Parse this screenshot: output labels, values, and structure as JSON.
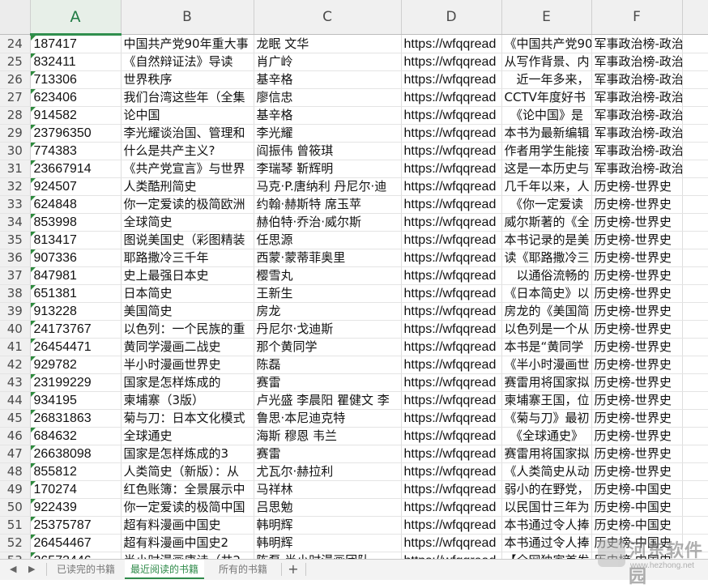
{
  "columns": [
    "A",
    "B",
    "C",
    "D",
    "E",
    "F"
  ],
  "rows": [
    {
      "n": "24",
      "a": "187417",
      "b": "中国共产党90年重大事",
      "c": "龙眠 文华",
      "d": "https://wfqqread",
      "e": "《中国共产党90",
      "f": "军事政治榜-政治"
    },
    {
      "n": "25",
      "a": "832411",
      "b": "《自然辩证法》导读",
      "c": "肖广岭",
      "d": "https://wfqqread",
      "e": "从写作背景、内",
      "f": "军事政治榜-政治"
    },
    {
      "n": "26",
      "a": "713306",
      "b": "世界秩序",
      "c": "基辛格",
      "d": "https://wfqqread",
      "e": "　近一年多来，",
      "f": "军事政治榜-政治"
    },
    {
      "n": "27",
      "a": "623406",
      "b": "我们台湾这些年（全集",
      "c": "廖信忠",
      "d": "https://wfqqread",
      "e": "CCTV年度好书",
      "f": "军事政治榜-政治"
    },
    {
      "n": "28",
      "a": "914582",
      "b": "论中国",
      "c": "基辛格",
      "d": "https://wfqqread",
      "e": "　《论中国》是",
      "f": "军事政治榜-政治"
    },
    {
      "n": "29",
      "a": "23796350",
      "b": "李光耀谈治国、管理和",
      "c": "李光耀",
      "d": "https://wfqqread",
      "e": "本书为最新编辑",
      "f": "军事政治榜-政治"
    },
    {
      "n": "30",
      "a": "774383",
      "b": "什么是共产主义?",
      "c": "阎振伟 曾筱琪",
      "d": "https://wfqqread",
      "e": "作者用学生能接",
      "f": "军事政治榜-政治"
    },
    {
      "n": "31",
      "a": "23667914",
      "b": "《共产党宣言》与世界",
      "c": "李瑞琴 靳辉明",
      "d": "https://wfqqread",
      "e": "这是一本历史与",
      "f": "军事政治榜-政治"
    },
    {
      "n": "32",
      "a": "924507",
      "b": "人类酷刑简史",
      "c": "马克·P.唐纳利 丹尼尔·迪",
      "d": "https://wfqqread",
      "e": "几千年以来，人",
      "f": "历史榜-世界史"
    },
    {
      "n": "33",
      "a": "624848",
      "b": "你一定爱读的极简欧洲",
      "c": "约翰·赫斯特 席玉苹",
      "d": "https://wfqqread",
      "e": "　《你一定爱读",
      "f": "历史榜-世界史"
    },
    {
      "n": "34",
      "a": "853998",
      "b": "全球简史",
      "c": "赫伯特·乔治·威尔斯",
      "d": "https://wfqqread",
      "e": "威尔斯著的《全",
      "f": "历史榜-世界史"
    },
    {
      "n": "35",
      "a": "813417",
      "b": "图说美国史（彩图精装",
      "c": "任思源",
      "d": "https://wfqqread",
      "e": "本书记录的是美",
      "f": "历史榜-世界史"
    },
    {
      "n": "36",
      "a": "907336",
      "b": "耶路撒冷三千年",
      "c": "西蒙·蒙蒂菲奥里",
      "d": "https://wfqqread",
      "e": "读《耶路撒冷三",
      "f": "历史榜-世界史"
    },
    {
      "n": "37",
      "a": "847981",
      "b": "史上最强日本史",
      "c": "樱雪丸",
      "d": "https://wfqqread",
      "e": "　以通俗流畅的",
      "f": "历史榜-世界史"
    },
    {
      "n": "38",
      "a": "651381",
      "b": "日本简史",
      "c": "王新生",
      "d": "https://wfqqread",
      "e": "《日本简史》以",
      "f": "历史榜-世界史"
    },
    {
      "n": "39",
      "a": "913228",
      "b": "美国简史",
      "c": "房龙",
      "d": "https://wfqqread",
      "e": "房龙的《美国简",
      "f": "历史榜-世界史"
    },
    {
      "n": "40",
      "a": "24173767",
      "b": "以色列：一个民族的重",
      "c": "丹尼尔·戈迪斯",
      "d": "https://wfqqread",
      "e": "以色列是一个从",
      "f": "历史榜-世界史"
    },
    {
      "n": "41",
      "a": "26454471",
      "b": "黄同学漫画二战史",
      "c": "那个黄同学",
      "d": "https://wfqqread",
      "e": "本书是“黄同学",
      "f": "历史榜-世界史"
    },
    {
      "n": "42",
      "a": "929782",
      "b": "半小时漫画世界史",
      "c": "陈磊",
      "d": "https://wfqqread",
      "e": "《半小时漫画世",
      "f": "历史榜-世界史"
    },
    {
      "n": "43",
      "a": "23199229",
      "b": "国家是怎样炼成的",
      "c": "赛雷",
      "d": "https://wfqqread",
      "e": "赛雷用将国家拟",
      "f": "历史榜-世界史"
    },
    {
      "n": "44",
      "a": "934195",
      "b": "柬埔寨（3版）",
      "c": "卢光盛 李晨阳 瞿健文 李",
      "d": "https://wfqqread",
      "e": "柬埔寨王国，位",
      "f": "历史榜-世界史"
    },
    {
      "n": "45",
      "a": "26831863",
      "b": "菊与刀：日本文化模式",
      "c": "鲁思·本尼迪克特",
      "d": "https://wfqqread",
      "e": "《菊与刀》最初",
      "f": "历史榜-世界史"
    },
    {
      "n": "46",
      "a": "684632",
      "b": "全球通史",
      "c": "海斯 穆恩 韦兰",
      "d": "https://wfqqread",
      "e": "　《全球通史》",
      "f": "历史榜-世界史"
    },
    {
      "n": "47",
      "a": "26638098",
      "b": "国家是怎样炼成的3",
      "c": "赛雷",
      "d": "https://wfqqread",
      "e": "赛雷用将国家拟",
      "f": "历史榜-世界史"
    },
    {
      "n": "48",
      "a": "855812",
      "b": "人类简史（新版）：从",
      "c": "尤瓦尔·赫拉利",
      "d": "https://wfqqread",
      "e": "《人类简史从动",
      "f": "历史榜-世界史"
    },
    {
      "n": "49",
      "a": "170274",
      "b": "红色账簿：全景展示中",
      "c": "马祥林",
      "d": "https://wfqqread",
      "e": "弱小的在野党，",
      "f": "历史榜-中国史"
    },
    {
      "n": "50",
      "a": "922439",
      "b": "你一定爱读的极简中国",
      "c": "吕思勉",
      "d": "https://wfqqread",
      "e": "以民国廿三年为",
      "f": "历史榜-中国史"
    },
    {
      "n": "51",
      "a": "25375787",
      "b": "超有料漫画中国史",
      "c": "韩明辉",
      "d": "https://wfqqread",
      "e": "本书通过令人捧",
      "f": "历史榜-中国史"
    },
    {
      "n": "52",
      "a": "26454467",
      "b": "超有料漫画中国史2",
      "c": "韩明辉",
      "d": "https://wfqqread",
      "e": "本书通过令人捧",
      "f": "历史榜-中国史"
    },
    {
      "n": "53",
      "a": "26573446",
      "b": "半小时漫画唐诗（共2",
      "c": "陈磊·半小时漫画团队",
      "d": "https://wfqqread",
      "e": "【全网独家首发",
      "f": "历史榜-中国史"
    }
  ],
  "sheet_tabs": [
    {
      "label": "已读完的书籍",
      "active": false
    },
    {
      "label": "最近阅读的书籍",
      "active": true
    },
    {
      "label": "所有的书籍",
      "active": false
    }
  ],
  "add_tab_label": "+",
  "watermark": {
    "text": "河东软件园",
    "url": "www.hezhong.net"
  },
  "colors": {
    "accent": "#2f8a4a",
    "header_bg": "#f0f0f0",
    "grid_line": "#dedede"
  }
}
